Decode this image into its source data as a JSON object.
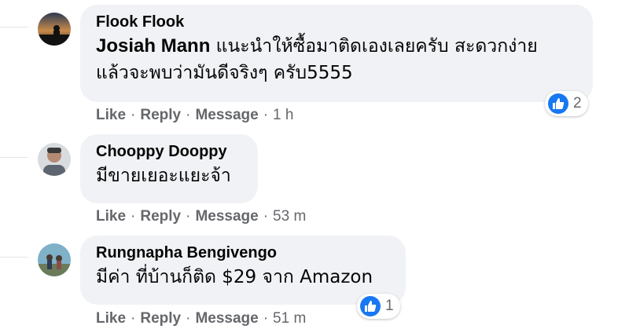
{
  "comments": [
    {
      "author": "Flook Flook",
      "mention": "Josiah Mann",
      "text_line1": " แนะนำให้ซื้อมาติดเองเลยครับ สะดวกง่าย",
      "text_line2": "แล้วจะพบว่ามันดีจริงๆ ครับ5555",
      "like_label": "Like",
      "reply_label": "Reply",
      "message_label": "Message",
      "time": "1 h",
      "reaction_count": "2"
    },
    {
      "author": "Chooppy Dooppy",
      "text_line1": "มีขายเยอะแยะจ้า",
      "like_label": "Like",
      "reply_label": "Reply",
      "message_label": "Message",
      "time": "53 m"
    },
    {
      "author": "Rungnapha Bengivengo",
      "text_line1": "มีค่า ที่บ้านก็ติด $29 จาก Amazon",
      "like_label": "Like",
      "reply_label": "Reply",
      "message_label": "Message",
      "time": "51 m",
      "reaction_count": "1"
    }
  ],
  "separator": "·",
  "colors": {
    "bubble": "#f0f2f5",
    "meta_text": "#65676b",
    "like_blue": "#1877f2"
  }
}
